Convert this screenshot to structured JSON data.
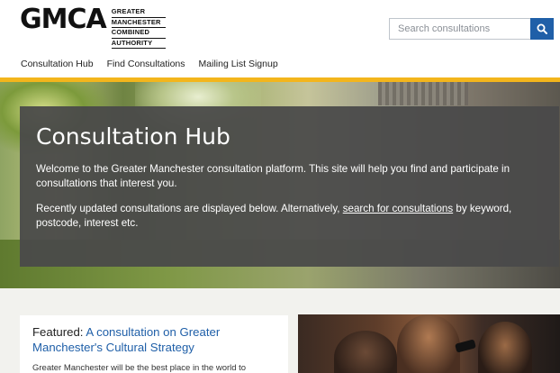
{
  "header": {
    "logo_mark": "GMCA",
    "logo_lines": [
      "GREATER",
      "MANCHESTER",
      "COMBINED",
      "AUTHORITY"
    ],
    "search_placeholder": "Search consultations",
    "search_icon": "search-icon"
  },
  "nav": {
    "items": [
      {
        "label": "Consultation Hub"
      },
      {
        "label": "Find Consultations"
      },
      {
        "label": "Mailing List Signup"
      }
    ]
  },
  "hero": {
    "accent_color": "#f3b51c",
    "title": "Consultation Hub",
    "intro": "Welcome to the Greater Manchester consultation platform. This site will help you find and participate in consultations that interest you.",
    "p2_before": "Recently updated consultations are displayed below. Alternatively, ",
    "p2_link": "search for consultations",
    "p2_after": " by keyword, postcode, interest etc."
  },
  "featured": {
    "prefix": "Featured: ",
    "title": "A consultation on Greater Manchester's Cultural Strategy",
    "text": "Greater Manchester will be the best place in the world to",
    "link_color": "#1f5fa8"
  }
}
